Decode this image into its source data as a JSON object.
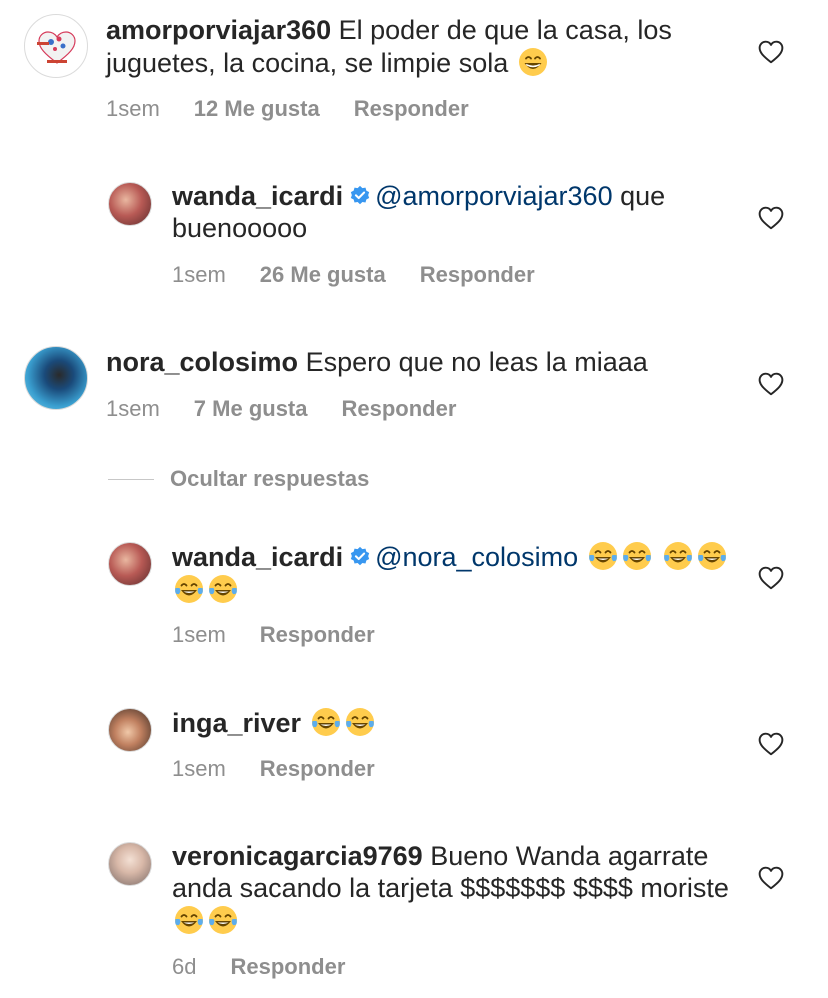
{
  "comments": [
    {
      "username": "amorporviajar360",
      "text": "El poder de que la casa, los juguetes, la cocina, se limpie sola",
      "time": "1sem",
      "likes": "12 Me gusta",
      "reply": "Responder",
      "avatar_icon": "heart-map-logo-icon",
      "emoji": [
        "grinning-face"
      ]
    },
    {
      "username": "wanda_icardi",
      "mention": "@amorporviajar360",
      "text": "que buenooooo",
      "time": "1sem",
      "likes": "26 Me gusta",
      "reply": "Responder",
      "verified": true
    },
    {
      "username": "nora_colosimo",
      "text": "Espero que no leas la miaaa",
      "time": "1sem",
      "likes": "7 Me gusta",
      "reply": "Responder"
    },
    {
      "username": "wanda_icardi",
      "mention": "@nora_colosimo",
      "time": "1sem",
      "reply": "Responder",
      "verified": true,
      "emoji": [
        "tears-of-joy",
        "tears-of-joy",
        "tears-of-joy",
        "tears-of-joy",
        "tears-of-joy",
        "tears-of-joy"
      ]
    },
    {
      "username": "inga_river",
      "time": "1sem",
      "reply": "Responder",
      "emoji": [
        "tears-of-joy",
        "tears-of-joy"
      ]
    },
    {
      "username": "veronicagarcia9769",
      "text": "Bueno Wanda agarrate anda sacando la tarjeta $$$$$$$ $$$$ moriste",
      "time": "6d",
      "reply": "Responder",
      "emoji": [
        "tears-of-joy",
        "tears-of-joy"
      ]
    }
  ],
  "hide_replies": "Ocultar respuestas",
  "colors": {
    "text": "#262626",
    "meta": "#8e8e8e",
    "mention": "#00376b",
    "verified": "#3897f0"
  }
}
